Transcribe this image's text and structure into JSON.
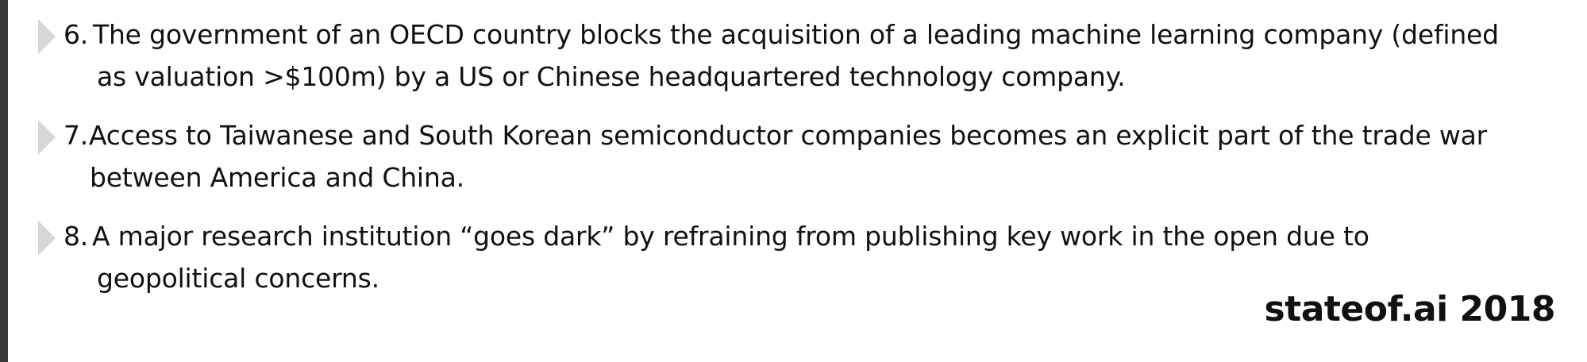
{
  "items": [
    {
      "number": "6.",
      "lines": [
        "The government of an OECD country blocks the acquisition of a leading machine learning company (defined",
        "as valuation >$100m) by a US or Chinese headquartered technology company."
      ]
    },
    {
      "number": "7.",
      "lines": [
        "Access to Taiwanese and South Korean semiconductor companies becomes an explicit part of the trade war",
        "between America and China."
      ]
    },
    {
      "number": "8.",
      "lines": [
        "A major research institution “goes dark” by refraining from publishing key work in the open due to",
        "geopolitical concerns."
      ]
    }
  ],
  "footer": {
    "brand": "stateof.ai 2018"
  }
}
